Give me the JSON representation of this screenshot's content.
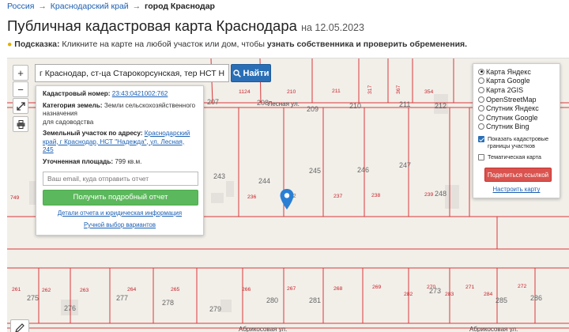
{
  "breadcrumb": {
    "items": [
      "Россия",
      "Краснодарский край"
    ],
    "separator": "→",
    "current": "город Краснодар"
  },
  "header": {
    "title": "Публичная кадастровая карта Краснодара",
    "date": "на 12.05.2023"
  },
  "hint": {
    "label": "Подсказка:",
    "text_before": "Кликните на карте на любой участок или дом, чтобы",
    "text_bold": "узнать собственника и проверить обременения."
  },
  "search": {
    "value": "г Краснодар, ст-ца Старокорсунская, тер НСТ Надежда, ул",
    "button_label": "Найти"
  },
  "controls": {
    "zoom_in": "+",
    "zoom_out": "−"
  },
  "info_panel": {
    "cadastral_label": "Кадастровый номер:",
    "cadastral_value": "23:43:0421002:762",
    "category_label": "Категория земель:",
    "category_value": "Земли сельскохозяйственного назначения",
    "category_note": "для садоводства",
    "address_label": "Земельный участок по адресу:",
    "address_value": "Краснодарский край, г Краснодар, НСТ \"Надежда\", ул. Лесная, 245",
    "area_label": "Уточненная площадь:",
    "area_value": "799 кв.м.",
    "email_placeholder": "Ваш email, куда отправить отчет",
    "report_button": "Получить подробный отчет",
    "details_link": "Детали отчета и юридическая информация",
    "manual_link": "Ручной выбор вариантов"
  },
  "layers": {
    "options": [
      {
        "label": "Карта Яндекс",
        "selected": true
      },
      {
        "label": "Карта Google",
        "selected": false
      },
      {
        "label": "Карта 2GIS",
        "selected": false
      },
      {
        "label": "OpenStreetMap",
        "selected": false
      },
      {
        "label": "Спутник Яндекс",
        "selected": false
      },
      {
        "label": "Спутник Google",
        "selected": false
      },
      {
        "label": "Спутник Bing",
        "selected": false
      }
    ],
    "show_boundaries_label": "Показать кадастровые границы участков",
    "show_boundaries_checked": true,
    "thematic_label": "Тематическая карта",
    "thematic_checked": false,
    "share_button": "Поделиться ссылкой",
    "setup_link": "Настроить карту"
  },
  "map": {
    "streets": {
      "top": "Лесная ул.",
      "bottom_left": "Абрикосовая ул.",
      "bottom_right": "Абрикосовая ул."
    },
    "numbers": {
      "n207": "207",
      "n208": "208",
      "n209": "209",
      "n210a": "210",
      "n210b": "210",
      "n211a": "211",
      "n211b": "211",
      "n212": "212",
      "n1124": "1124",
      "n317": "317",
      "n367": "367",
      "n354": "354",
      "n243": "243",
      "n244": "244",
      "n245": "245",
      "n246": "246",
      "n247": "247",
      "n236": "236",
      "n762": "762",
      "n237": "237",
      "n238": "238",
      "n239": "239",
      "n248": "248",
      "n749": "749",
      "n261": "261",
      "n262": "262",
      "n263": "263",
      "n264": "264",
      "n265": "265",
      "n266": "266",
      "n267": "267",
      "n268": "268",
      "n269": "269",
      "n270": "270",
      "n271": "271",
      "n272": "272",
      "n273": "273",
      "n275": "275",
      "n276": "276",
      "n277": "277",
      "n278": "278",
      "n279": "279",
      "n280": "280",
      "n281": "281",
      "n282": "282",
      "n283": "283",
      "n284": "284",
      "n285": "285",
      "n286": "286"
    }
  },
  "colors": {
    "boundary": "#d9383a",
    "accent": "#2a6fb6",
    "report": "#5cb85c",
    "share": "#d9534f",
    "marker": "#2a7fd4"
  }
}
